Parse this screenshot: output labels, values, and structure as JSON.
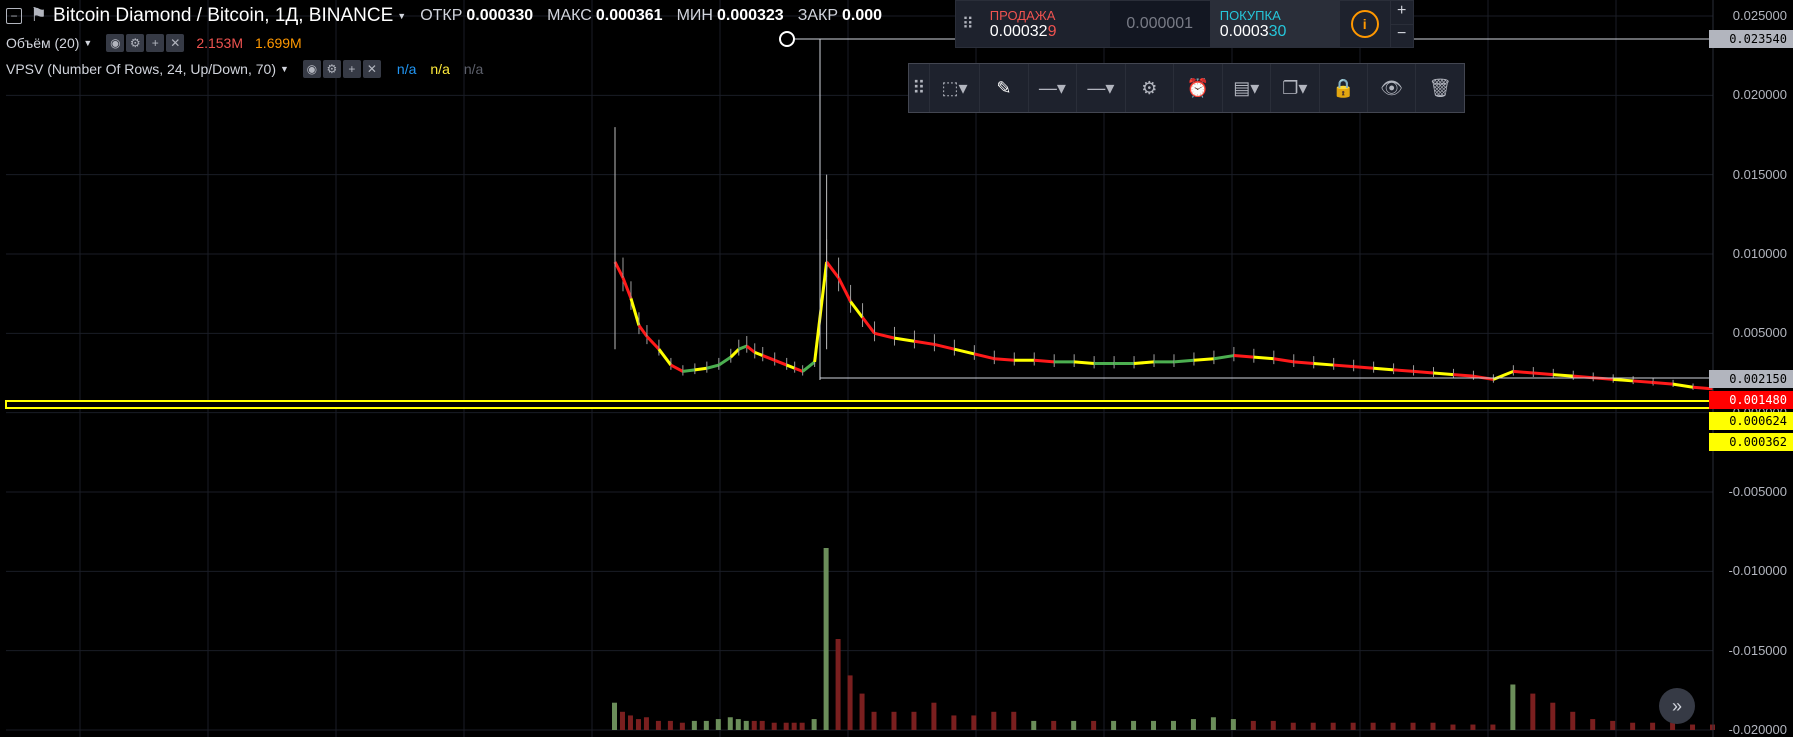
{
  "header": {
    "symbol_title": "Bitcoin Diamond / Bitcoin, 1Д, BINANCE",
    "open_label": "ОТКР",
    "open_value": "0.000330",
    "high_label": "МАКС",
    "high_value": "0.000361",
    "low_label": "МИН",
    "low_value": "0.000323",
    "close_label": "ЗАКР",
    "close_value": "0.000"
  },
  "indicators": {
    "volume_title": "Объём (20)",
    "volume_value_1": "2.153M",
    "volume_value_2": "1.699M",
    "vpsv_title": "VPSV (Number Of Rows, 24, Up/Down, 70)",
    "vpsv_val_1": "n/a",
    "vpsv_val_2": "n/a",
    "vpsv_val_3": "n/a"
  },
  "trade": {
    "sell_label": "ПРОДАЖА",
    "sell_price_main": "0.00032",
    "sell_price_tail": "9",
    "spread": "0.000001",
    "buy_label": "ПОКУПКА",
    "buy_price_main": "0.0003",
    "buy_price_tail": "30",
    "plus": "+",
    "minus": "−"
  },
  "toolbar_icons": [
    "drag-handle-icon",
    "select-area-icon",
    "pencil-icon",
    "line-style-icon",
    "line-width-icon",
    "gear-icon",
    "add-alert-icon",
    "layers-icon",
    "clone-icon",
    "lock-icon",
    "eye-icon",
    "trash-icon"
  ],
  "axis": {
    "price_ticks": [
      "0.025000",
      "0.020000",
      "0.015000",
      "0.010000",
      "0.005000",
      "0.000000",
      "-0.005000",
      "-0.010000",
      "-0.015000",
      "-0.020000"
    ],
    "tag_top": "0.023540",
    "tag_2": "0.002150",
    "tag_3": "0.001480",
    "tag_4": "0.000624",
    "tag_5": "0.000362"
  },
  "colors": {
    "up": "#26a69a",
    "down": "#ef5350",
    "highlight": "#ffff00",
    "accent_orange": "#ff9800",
    "sell": "#ef5350",
    "buy": "#26c6da"
  },
  "chart_data": {
    "type": "line",
    "ylim": [
      -0.02,
      0.025
    ],
    "title": "",
    "xlabel": "",
    "ylabel": "",
    "series": [
      {
        "name": "",
        "x": [
          0,
          4,
          8,
          12,
          16,
          22,
          28,
          34,
          40,
          46,
          52,
          58,
          62,
          66,
          70,
          74,
          80,
          86,
          90,
          94,
          100,
          106,
          112,
          118,
          124,
          130,
          140,
          150,
          160,
          170,
          180,
          190,
          200,
          210,
          220,
          230,
          240,
          250,
          260,
          270,
          280,
          290,
          300,
          310,
          320,
          330,
          340,
          350,
          360,
          370,
          380,
          390,
          400,
          410,
          420,
          430,
          440,
          450,
          460,
          470,
          480,
          490,
          500,
          510,
          520,
          530,
          540,
          550
        ],
        "values": [
          0.0095,
          0.0085,
          0.0072,
          0.0055,
          0.0048,
          0.004,
          0.003,
          0.0026,
          0.0027,
          0.0028,
          0.003,
          0.0035,
          0.004,
          0.0042,
          0.0038,
          0.0036,
          0.0033,
          0.003,
          0.0028,
          0.0026,
          0.0032,
          0.0095,
          0.0085,
          0.007,
          0.006,
          0.005,
          0.0047,
          0.0045,
          0.0043,
          0.004,
          0.0037,
          0.0034,
          0.0033,
          0.0033,
          0.0032,
          0.0032,
          0.0031,
          0.0031,
          0.0031,
          0.0032,
          0.0032,
          0.0033,
          0.0034,
          0.0036,
          0.0035,
          0.0034,
          0.0032,
          0.0031,
          0.003,
          0.0029,
          0.0028,
          0.0027,
          0.0026,
          0.0025,
          0.0024,
          0.0023,
          0.0021,
          0.0026,
          0.0025,
          0.0024,
          0.0023,
          0.0022,
          0.0021,
          0.002,
          0.0019,
          0.0018,
          0.0016,
          0.0015
        ]
      }
    ],
    "volumes": [
      0.15,
      0.1,
      0.08,
      0.06,
      0.07,
      0.05,
      0.05,
      0.04,
      0.05,
      0.05,
      0.06,
      0.07,
      0.06,
      0.05,
      0.05,
      0.05,
      0.04,
      0.04,
      0.04,
      0.04,
      0.06,
      1.0,
      0.5,
      0.3,
      0.2,
      0.1,
      0.1,
      0.1,
      0.15,
      0.08,
      0.08,
      0.1,
      0.1,
      0.05,
      0.05,
      0.05,
      0.05,
      0.05,
      0.05,
      0.05,
      0.05,
      0.06,
      0.07,
      0.06,
      0.05,
      0.05,
      0.04,
      0.04,
      0.04,
      0.04,
      0.04,
      0.04,
      0.04,
      0.04,
      0.03,
      0.03,
      0.03,
      0.25,
      0.2,
      0.15,
      0.1,
      0.06,
      0.05,
      0.04,
      0.04,
      0.04,
      0.03,
      0.03
    ]
  }
}
